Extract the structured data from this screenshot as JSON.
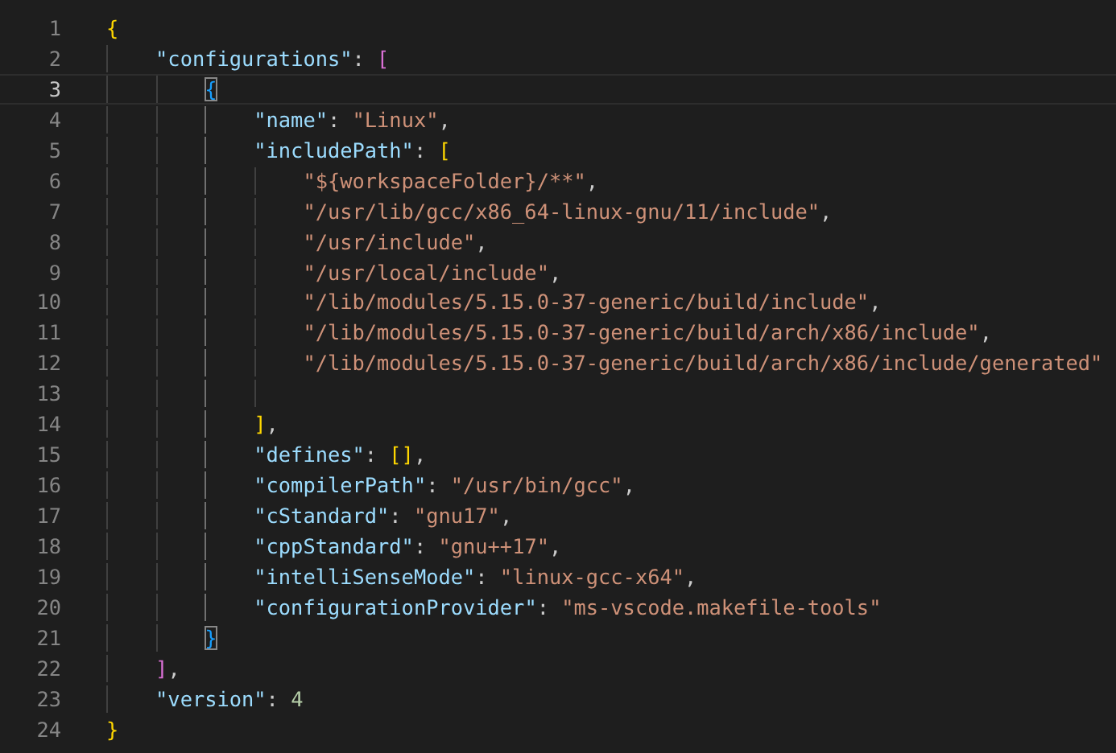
{
  "editor": {
    "lines": [
      {
        "number": "1",
        "current": false,
        "tokens": [
          {
            "kind": "bracket",
            "text": "{",
            "color": "#ffd700",
            "matched": false
          }
        ]
      },
      {
        "number": "2",
        "current": false,
        "tokens": [
          {
            "kind": "key",
            "text": "\"configurations\""
          },
          {
            "kind": "punct",
            "text": ": "
          },
          {
            "kind": "bracket",
            "text": "[",
            "color": "#da70d6",
            "matched": false
          }
        ]
      },
      {
        "number": "3",
        "current": true,
        "tokens": [
          {
            "kind": "bracket",
            "text": "{",
            "color": "#179fff",
            "matched": true
          }
        ]
      },
      {
        "number": "4",
        "current": false,
        "tokens": [
          {
            "kind": "key",
            "text": "\"name\""
          },
          {
            "kind": "punct",
            "text": ": "
          },
          {
            "kind": "string",
            "text": "\"Linux\""
          },
          {
            "kind": "punct",
            "text": ","
          }
        ]
      },
      {
        "number": "5",
        "current": false,
        "tokens": [
          {
            "kind": "key",
            "text": "\"includePath\""
          },
          {
            "kind": "punct",
            "text": ": "
          },
          {
            "kind": "bracket",
            "text": "[",
            "color": "#ffd700",
            "matched": false
          }
        ]
      },
      {
        "number": "6",
        "current": false,
        "tokens": [
          {
            "kind": "string",
            "text": "\"${workspaceFolder}/**\""
          },
          {
            "kind": "punct",
            "text": ","
          }
        ]
      },
      {
        "number": "7",
        "current": false,
        "tokens": [
          {
            "kind": "string",
            "text": "\"/usr/lib/gcc/x86_64-linux-gnu/11/include\""
          },
          {
            "kind": "punct",
            "text": ","
          }
        ]
      },
      {
        "number": "8",
        "current": false,
        "tokens": [
          {
            "kind": "string",
            "text": "\"/usr/include\""
          },
          {
            "kind": "punct",
            "text": ","
          }
        ]
      },
      {
        "number": "9",
        "current": false,
        "tokens": [
          {
            "kind": "string",
            "text": "\"/usr/local/include\""
          },
          {
            "kind": "punct",
            "text": ","
          }
        ]
      },
      {
        "number": "10",
        "current": false,
        "tokens": [
          {
            "kind": "string",
            "text": "\"/lib/modules/5.15.0-37-generic/build/include\""
          },
          {
            "kind": "punct",
            "text": ","
          }
        ]
      },
      {
        "number": "11",
        "current": false,
        "tokens": [
          {
            "kind": "string",
            "text": "\"/lib/modules/5.15.0-37-generic/build/arch/x86/include\""
          },
          {
            "kind": "punct",
            "text": ","
          }
        ]
      },
      {
        "number": "12",
        "current": false,
        "tokens": [
          {
            "kind": "string",
            "text": "\"/lib/modules/5.15.0-37-generic/build/arch/x86/include/generated\""
          }
        ]
      },
      {
        "number": "13",
        "current": false
      },
      {
        "number": "14",
        "current": false,
        "tokens": [
          {
            "kind": "bracket",
            "text": "]",
            "color": "#ffd700",
            "matched": false
          },
          {
            "kind": "punct",
            "text": ","
          }
        ]
      },
      {
        "number": "15",
        "current": false,
        "tokens": [
          {
            "kind": "key",
            "text": "\"defines\""
          },
          {
            "kind": "punct",
            "text": ": "
          },
          {
            "kind": "bracket",
            "text": "[]",
            "color": "#ffd700",
            "matched": false
          },
          {
            "kind": "punct",
            "text": ","
          }
        ]
      },
      {
        "number": "16",
        "current": false,
        "tokens": [
          {
            "kind": "key",
            "text": "\"compilerPath\""
          },
          {
            "kind": "punct",
            "text": ": "
          },
          {
            "kind": "string",
            "text": "\"/usr/bin/gcc\""
          },
          {
            "kind": "punct",
            "text": ","
          }
        ]
      },
      {
        "number": "17",
        "current": false,
        "tokens": [
          {
            "kind": "key",
            "text": "\"cStandard\""
          },
          {
            "kind": "punct",
            "text": ": "
          },
          {
            "kind": "string",
            "text": "\"gnu17\""
          },
          {
            "kind": "punct",
            "text": ","
          }
        ]
      },
      {
        "number": "18",
        "current": false,
        "tokens": [
          {
            "kind": "key",
            "text": "\"cppStandard\""
          },
          {
            "kind": "punct",
            "text": ": "
          },
          {
            "kind": "string",
            "text": "\"gnu++17\""
          },
          {
            "kind": "punct",
            "text": ","
          }
        ]
      },
      {
        "number": "19",
        "current": false,
        "tokens": [
          {
            "kind": "key",
            "text": "\"intelliSenseMode\""
          },
          {
            "kind": "punct",
            "text": ": "
          },
          {
            "kind": "string",
            "text": "\"linux-gcc-x64\""
          },
          {
            "kind": "punct",
            "text": ","
          }
        ]
      },
      {
        "number": "20",
        "current": false,
        "tokens": [
          {
            "kind": "key",
            "text": "\"configurationProvider\""
          },
          {
            "kind": "punct",
            "text": ": "
          },
          {
            "kind": "string",
            "text": "\"ms-vscode.makefile-tools\""
          }
        ]
      },
      {
        "number": "21",
        "current": false,
        "tokens": [
          {
            "kind": "bracket",
            "text": "}",
            "color": "#179fff",
            "matched": true
          }
        ]
      },
      {
        "number": "22",
        "current": false,
        "tokens": [
          {
            "kind": "bracket",
            "text": "]",
            "color": "#da70d6",
            "matched": false
          },
          {
            "kind": "punct",
            "text": ","
          }
        ]
      },
      {
        "number": "23",
        "current": false,
        "tokens": [
          {
            "kind": "key",
            "text": "\"version\""
          },
          {
            "kind": "punct",
            "text": ": "
          },
          {
            "kind": "number",
            "text": "4"
          }
        ]
      },
      {
        "number": "24",
        "current": false,
        "tokens": [
          {
            "kind": "bracket",
            "text": "}",
            "color": "#ffd700",
            "matched": false
          }
        ]
      }
    ]
  }
}
